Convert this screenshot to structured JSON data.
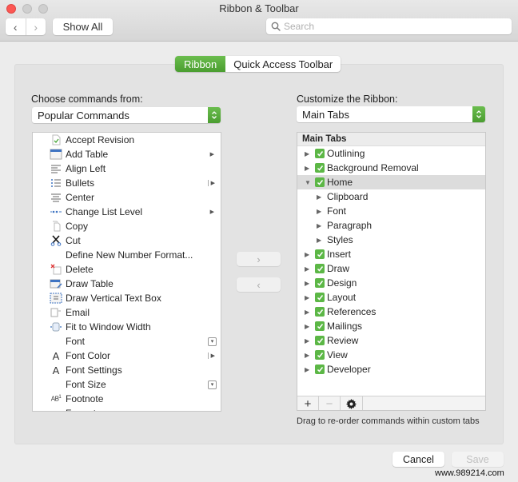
{
  "window": {
    "title": "Ribbon & Toolbar"
  },
  "toolbar": {
    "back_label": "‹",
    "forward_label": "›",
    "show_all_label": "Show All",
    "search_placeholder": "Search",
    "search_value": ""
  },
  "tabs": [
    {
      "label": "Ribbon",
      "active": true
    },
    {
      "label": "Quick Access Toolbar",
      "active": false
    }
  ],
  "left": {
    "label": "Choose commands from:",
    "select_value": "Popular Commands",
    "commands": [
      {
        "label": "Accept Revision",
        "icon": "accept-revision-icon",
        "suffix": ""
      },
      {
        "label": "Add Table",
        "icon": "table-icon",
        "suffix": "arrow"
      },
      {
        "label": "Align Left",
        "icon": "align-left-icon",
        "suffix": ""
      },
      {
        "label": "Bullets",
        "icon": "bullets-icon",
        "suffix": "split-arrow"
      },
      {
        "label": "Center",
        "icon": "align-center-icon",
        "suffix": ""
      },
      {
        "label": "Change List Level",
        "icon": "list-level-icon",
        "suffix": "arrow"
      },
      {
        "label": "Copy",
        "icon": "copy-icon",
        "suffix": ""
      },
      {
        "label": "Cut",
        "icon": "scissors-icon",
        "suffix": ""
      },
      {
        "label": "Define New Number Format...",
        "icon": "",
        "suffix": ""
      },
      {
        "label": "Delete",
        "icon": "delete-icon",
        "suffix": ""
      },
      {
        "label": "Draw Table",
        "icon": "draw-table-icon",
        "suffix": ""
      },
      {
        "label": "Draw Vertical Text Box",
        "icon": "text-box-icon",
        "suffix": ""
      },
      {
        "label": "Email",
        "icon": "email-icon",
        "suffix": ""
      },
      {
        "label": "Fit to Window Width",
        "icon": "fit-width-icon",
        "suffix": ""
      },
      {
        "label": "Font",
        "icon": "",
        "suffix": "spin"
      },
      {
        "label": "Font Color",
        "icon": "font-color-icon",
        "suffix": "split-arrow"
      },
      {
        "label": "Font Settings",
        "icon": "font-settings-icon",
        "suffix": ""
      },
      {
        "label": "Font Size",
        "icon": "",
        "suffix": "spin"
      },
      {
        "label": "Footnote",
        "icon": "footnote-icon",
        "suffix": ""
      },
      {
        "label": "Format...",
        "icon": "format-icon",
        "suffix": ""
      }
    ]
  },
  "move": {
    "add_label": "›",
    "remove_label": "‹"
  },
  "right": {
    "label": "Customize the Ribbon:",
    "select_value": "Main Tabs",
    "tree_header": "Main Tabs",
    "items": [
      {
        "label": "Outlining",
        "level": 0,
        "expanded": false,
        "checked": true,
        "selected": false
      },
      {
        "label": "Background Removal",
        "level": 0,
        "expanded": false,
        "checked": true,
        "selected": false
      },
      {
        "label": "Home",
        "level": 0,
        "expanded": true,
        "checked": true,
        "selected": true
      },
      {
        "label": "Clipboard",
        "level": 1,
        "expanded": false,
        "checked": null,
        "selected": false
      },
      {
        "label": "Font",
        "level": 1,
        "expanded": false,
        "checked": null,
        "selected": false
      },
      {
        "label": "Paragraph",
        "level": 1,
        "expanded": false,
        "checked": null,
        "selected": false
      },
      {
        "label": "Styles",
        "level": 1,
        "expanded": false,
        "checked": null,
        "selected": false
      },
      {
        "label": "Insert",
        "level": 0,
        "expanded": false,
        "checked": true,
        "selected": false
      },
      {
        "label": "Draw",
        "level": 0,
        "expanded": false,
        "checked": true,
        "selected": false
      },
      {
        "label": "Design",
        "level": 0,
        "expanded": false,
        "checked": true,
        "selected": false
      },
      {
        "label": "Layout",
        "level": 0,
        "expanded": false,
        "checked": true,
        "selected": false
      },
      {
        "label": "References",
        "level": 0,
        "expanded": false,
        "checked": true,
        "selected": false
      },
      {
        "label": "Mailings",
        "level": 0,
        "expanded": false,
        "checked": true,
        "selected": false
      },
      {
        "label": "Review",
        "level": 0,
        "expanded": false,
        "checked": true,
        "selected": false
      },
      {
        "label": "View",
        "level": 0,
        "expanded": false,
        "checked": true,
        "selected": false
      },
      {
        "label": "Developer",
        "level": 0,
        "expanded": false,
        "checked": true,
        "selected": false
      }
    ],
    "footer": {
      "add_label": "+",
      "remove_label": "−"
    },
    "hint": "Drag to re-order commands within custom tabs"
  },
  "buttons": {
    "cancel_label": "Cancel",
    "save_label": "Save"
  },
  "watermark": "www.989214.com",
  "colors": {
    "accent_green": "#5cb746",
    "close_red": "#fc5753"
  }
}
